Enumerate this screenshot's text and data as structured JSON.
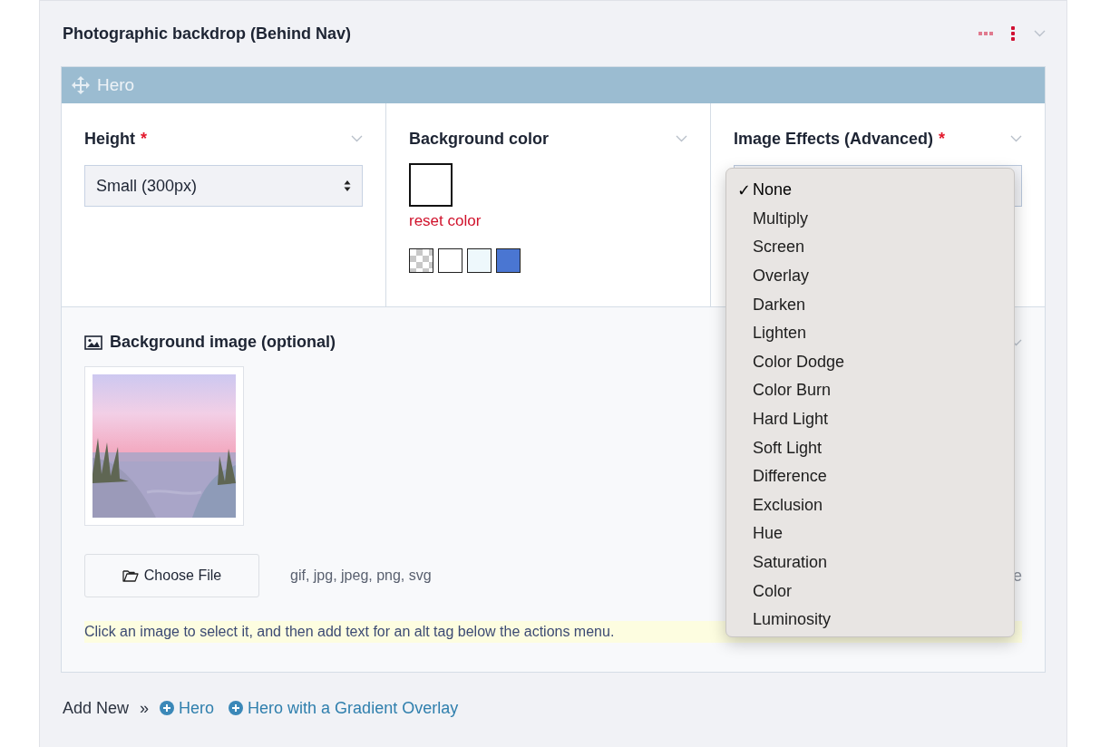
{
  "section": {
    "title": "Photographic backdrop (Behind Nav)"
  },
  "block": {
    "title": "Hero"
  },
  "fields": [
    {
      "kind": "select",
      "label": "Height",
      "required": true,
      "required_mark": "*",
      "value": "Small (300px)"
    },
    {
      "kind": "color",
      "label": "Background color",
      "required": false,
      "reset": "reset color",
      "swatches": [
        {
          "kind": "checker"
        },
        {
          "kind": "solid",
          "color": "#ffffff"
        },
        {
          "kind": "solid",
          "color": "#eef8fc"
        },
        {
          "kind": "solid",
          "color": "#4a76d2"
        }
      ]
    },
    {
      "kind": "dropdown",
      "label": "Image Effects (Advanced)",
      "required": true,
      "required_mark": "*"
    }
  ],
  "image_section": {
    "title": "Background image (optional)",
    "button": "Choose File",
    "formats": "gif, jpg, jpeg, png, svg",
    "covered_text": "e",
    "hint": "Click an image to select it, and then add text for an alt tag below the actions menu."
  },
  "dropdown": {
    "check_mark": "✓",
    "options": [
      {
        "label": "None",
        "selected": true
      },
      {
        "label": "Multiply",
        "selected": false
      },
      {
        "label": "Screen",
        "selected": false
      },
      {
        "label": "Overlay",
        "selected": false
      },
      {
        "label": "Darken",
        "selected": false
      },
      {
        "label": "Lighten",
        "selected": false
      },
      {
        "label": "Color Dodge",
        "selected": false
      },
      {
        "label": "Color Burn",
        "selected": false
      },
      {
        "label": "Hard Light",
        "selected": false
      },
      {
        "label": "Soft Light",
        "selected": false
      },
      {
        "label": "Difference",
        "selected": false
      },
      {
        "label": "Exclusion",
        "selected": false
      },
      {
        "label": "Hue",
        "selected": false
      },
      {
        "label": "Saturation",
        "selected": false
      },
      {
        "label": "Color",
        "selected": false
      },
      {
        "label": "Luminosity",
        "selected": false
      }
    ]
  },
  "add_new": {
    "label": "Add New",
    "separator": "»",
    "links": [
      "Hero",
      "Hero with a Gradient Overlay"
    ]
  }
}
